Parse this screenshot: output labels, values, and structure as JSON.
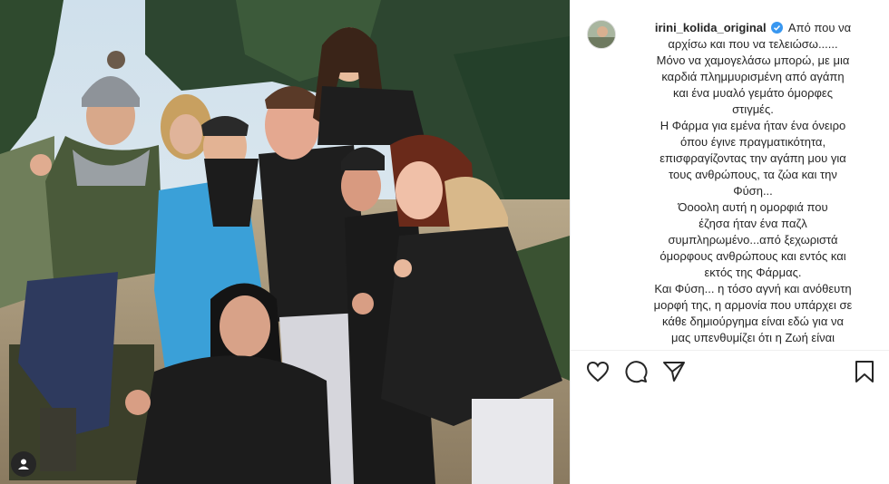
{
  "post": {
    "username": "irini_kolida_original",
    "caption_lines": [
      "Από που να",
      "αρχίσω και που να τελειώσω......",
      "Μόνο να χαμογελάσω μπορώ, με μια",
      "καρδιά πλημμυρισμένη από αγάπη",
      "και ένα μυαλό γεμάτο όμορφες",
      "στιγμές.",
      "Η Φάρμα για εμένα ήταν ένα όνειρο",
      "όπου έγινε πραγματικότητα,",
      "επισφραγίζοντας την αγάπη μου για",
      "τους ανθρώπους, τα ζώα και την",
      "Φύση...",
      "Όοοολη αυτή η ομορφιά που",
      "έζησα ήταν ένα παζλ",
      "συμπληρωμένο...από ξεχωριστά",
      "όμορφους ανθρώπους και εντός και",
      "εκτός της Φάρμας.",
      "Και Φύση... η τόσο αγνή και ανόθευτη",
      "μορφή της, η αρμονία που υπάρχει σε",
      "κάθε δημιούργημα είναι εδώ για να",
      "μας υπενθυμίζει ότι η Ζωή είναι"
    ]
  },
  "icons": {
    "like": "heart-icon",
    "comment": "comment-icon",
    "share": "share-icon",
    "save": "bookmark-icon",
    "verified": "verified-badge-icon",
    "tag": "user-tag-icon"
  },
  "colors": {
    "text": "#262626",
    "verified": "#3897f0",
    "border": "#efefef"
  }
}
